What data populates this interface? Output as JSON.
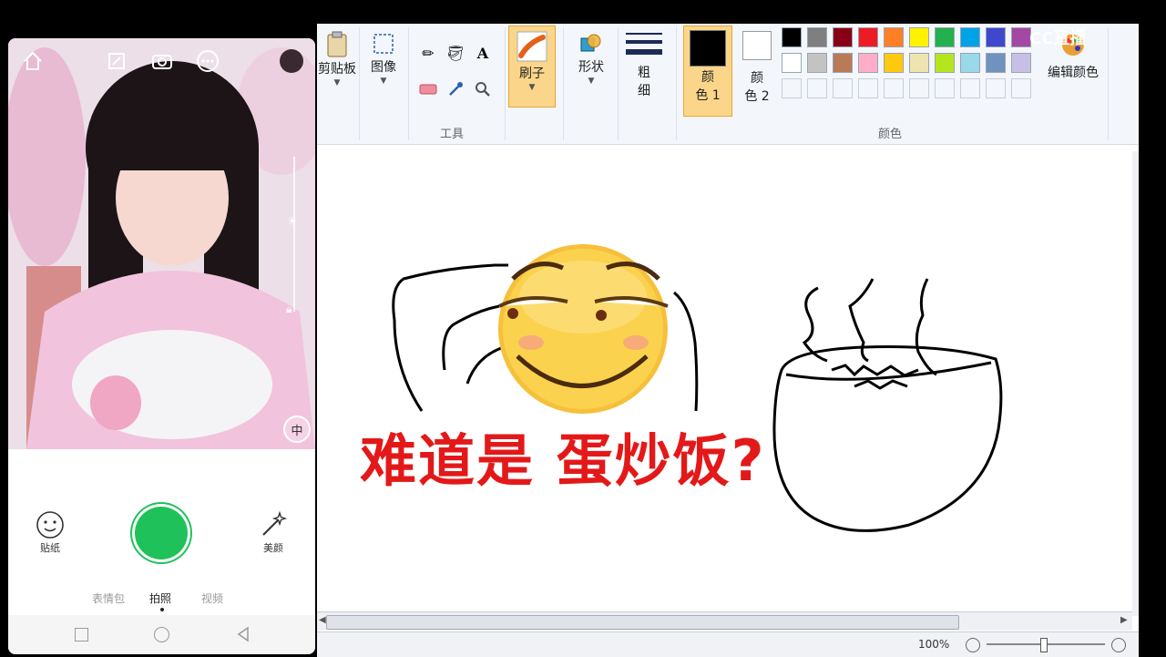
{
  "phone": {
    "controls_right": [
      "中"
    ],
    "tools": {
      "sticker_label": "贴纸",
      "beauty_label": "美颜"
    },
    "modes": [
      "表情包",
      "拍照",
      "视频"
    ],
    "active_mode": "拍照",
    "icons": [
      "home-icon",
      "edit-icon",
      "camera-switch-icon",
      "more-icon",
      "sun-icon",
      "lock-icon",
      "sticker-icon",
      "magic-wand-icon"
    ]
  },
  "paint": {
    "ribbon": {
      "clipboard_label": "剪贴板",
      "image_label": "图像",
      "tools_group_label": "工具",
      "brush_label": "刷子",
      "shapes_label": "形状",
      "size_label_1": "粗",
      "size_label_2": "细",
      "color1_label_1": "颜",
      "color1_label_2": "色 1",
      "color2_label_1": "颜",
      "color2_label_2": "色 2",
      "colors_group_label": "颜色",
      "edit_colors_label": "编辑颜色"
    },
    "palette_row1": [
      "#000000",
      "#7f7f7f",
      "#880015",
      "#ed1c24",
      "#ff7f27",
      "#fff200",
      "#22b14c",
      "#00a2e8",
      "#3f48cc",
      "#a349a4"
    ],
    "palette_row2": [
      "#ffffff",
      "#c3c3c3",
      "#b97a57",
      "#ffaec9",
      "#ffc90e",
      "#efe4b0",
      "#b5e61d",
      "#99d9ea",
      "#7092be",
      "#c8bfe7"
    ],
    "status_zoom": "100%"
  },
  "overlay": {
    "caption": "难道是 蛋炒饭?"
  },
  "watermark": {
    "text": "CC直播"
  }
}
